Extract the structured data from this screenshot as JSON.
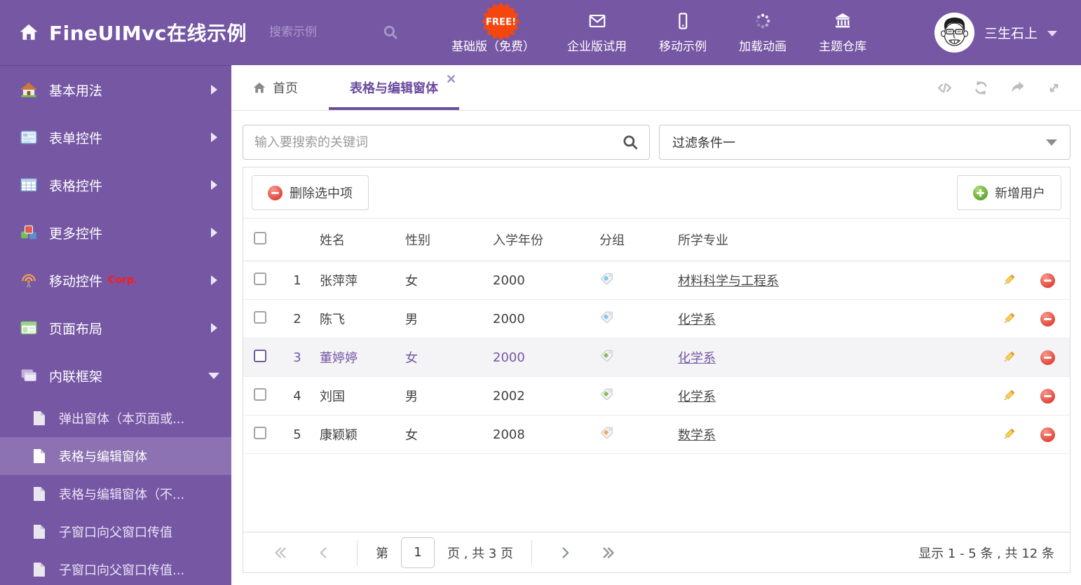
{
  "colors": {
    "accent": "#7657A4",
    "header_bg": "#7657A4",
    "free_badge": "#F4470F",
    "tag_blue": "#7EC8F5",
    "tag_green": "#8CC152",
    "tag_orange": "#F6A95C",
    "delete_red": "#E2483C",
    "add_green": "#5FA832"
  },
  "header": {
    "title": "FineUIMvc在线示例",
    "search_placeholder": "搜索示例",
    "free_badge": "FREE!",
    "nav": [
      {
        "label": "基础版（免费）",
        "icon": "download-icon"
      },
      {
        "label": "企业版试用",
        "icon": "envelope-icon"
      },
      {
        "label": "移动示例",
        "icon": "phone-icon"
      },
      {
        "label": "加载动画",
        "icon": "spinner-icon"
      },
      {
        "label": "主题仓库",
        "icon": "bank-icon"
      }
    ],
    "user_name": "三生石上"
  },
  "sidebar": {
    "items": [
      {
        "label": "基本用法",
        "icon": "house-icon"
      },
      {
        "label": "表单控件",
        "icon": "form-icon"
      },
      {
        "label": "表格控件",
        "icon": "table-icon"
      },
      {
        "label": "更多控件",
        "icon": "cubes-icon"
      },
      {
        "label": "移动控件",
        "icon": "antenna-icon",
        "badge": "Corp."
      },
      {
        "label": "页面布局",
        "icon": "layout-icon"
      },
      {
        "label": "内联框架",
        "icon": "frames-icon",
        "expanded": true
      }
    ],
    "subitems": [
      {
        "label": "弹出窗体（本页面或..."
      },
      {
        "label": "表格与编辑窗体",
        "selected": true
      },
      {
        "label": "表格与编辑窗体（不..."
      },
      {
        "label": "子窗口向父窗口传值"
      },
      {
        "label": "子窗口向父窗口传值..."
      }
    ]
  },
  "tabs": {
    "home_label": "首页",
    "active_label": "表格与编辑窗体"
  },
  "filter_bar": {
    "search_placeholder": "输入要搜索的关键词",
    "dropdown_value": "过滤条件一"
  },
  "toolbar": {
    "delete_label": "删除选中项",
    "add_label": "新增用户"
  },
  "grid": {
    "columns": [
      "姓名",
      "性别",
      "入学年份",
      "分组",
      "所学专业"
    ],
    "rows": [
      {
        "num": "1",
        "name": "张萍萍",
        "gender": "女",
        "year": "2000",
        "tag_class": "tag tag-blue",
        "major": "材料科学与工程系",
        "row_class": "grid-row",
        "selected": false
      },
      {
        "num": "2",
        "name": "陈飞",
        "gender": "男",
        "year": "2000",
        "tag_class": "tag tag-blue",
        "major": "化学系",
        "row_class": "grid-row",
        "selected": false
      },
      {
        "num": "3",
        "name": "董婷婷",
        "gender": "女",
        "year": "2000",
        "tag_class": "tag tag-green",
        "major": "化学系",
        "row_class": "grid-row selected",
        "selected": true
      },
      {
        "num": "4",
        "name": "刘国",
        "gender": "男",
        "year": "2002",
        "tag_class": "tag tag-green",
        "major": "化学系",
        "row_class": "grid-row",
        "selected": false
      },
      {
        "num": "5",
        "name": "康颖颖",
        "gender": "女",
        "year": "2008",
        "tag_class": "tag tag-orange",
        "major": "数学系",
        "row_class": "grid-row",
        "selected": false
      }
    ]
  },
  "pagination": {
    "page_prefix": "第",
    "page": "1",
    "page_suffix": "页 , 共 3 页",
    "summary": "显示 1 - 5 条 , 共 12 条"
  }
}
